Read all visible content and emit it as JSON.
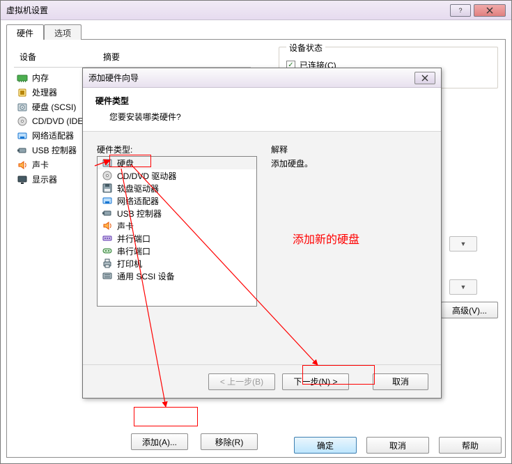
{
  "parent": {
    "title": "虚拟机设置",
    "tabs": {
      "hardware": "硬件",
      "options": "选项"
    },
    "device_columns": {
      "device": "设备",
      "summary": "摘要"
    },
    "devices": [
      {
        "name": "内存",
        "icon": "memory-icon"
      },
      {
        "name": "处理器",
        "icon": "cpu-icon"
      },
      {
        "name": "硬盘 (SCSI)",
        "icon": "disk-icon"
      },
      {
        "name": "CD/DVD (IDE)",
        "icon": "cd-icon"
      },
      {
        "name": "网络适配器",
        "icon": "nic-icon"
      },
      {
        "name": "USB 控制器",
        "icon": "usb-icon"
      },
      {
        "name": "声卡",
        "icon": "sound-icon"
      },
      {
        "name": "显示器",
        "icon": "display-icon"
      }
    ],
    "status": {
      "group": "设备状态",
      "connected": "已连接(C)"
    },
    "advanced": "高级(V)...",
    "buttons": {
      "add": "添加(A)...",
      "remove": "移除(R)",
      "ok": "确定",
      "cancel": "取消",
      "help": "帮助"
    }
  },
  "wizard": {
    "title": "添加硬件向导",
    "header": {
      "h1": "硬件类型",
      "sub": "您要安装哪类硬件?"
    },
    "list_label": "硬件类型:",
    "items": [
      {
        "name": "硬盘",
        "icon": "disk-icon"
      },
      {
        "name": "CD/DVD 驱动器",
        "icon": "cd-icon"
      },
      {
        "name": "软盘驱动器",
        "icon": "floppy-icon"
      },
      {
        "name": "网络适配器",
        "icon": "nic-icon"
      },
      {
        "name": "USB 控制器",
        "icon": "usb-icon"
      },
      {
        "name": "声卡",
        "icon": "sound-icon"
      },
      {
        "name": "并行端口",
        "icon": "parallel-icon"
      },
      {
        "name": "串行端口",
        "icon": "serial-icon"
      },
      {
        "name": "打印机",
        "icon": "printer-icon"
      },
      {
        "name": "通用 SCSI 设备",
        "icon": "scsi-icon"
      }
    ],
    "explain_label": "解释",
    "explain_text": "添加硬盘。",
    "footer": {
      "back": "< 上一步(B)",
      "next": "下一步(N) >",
      "cancel": "取消"
    }
  },
  "annotation": {
    "text": "添加新的硬盘"
  }
}
